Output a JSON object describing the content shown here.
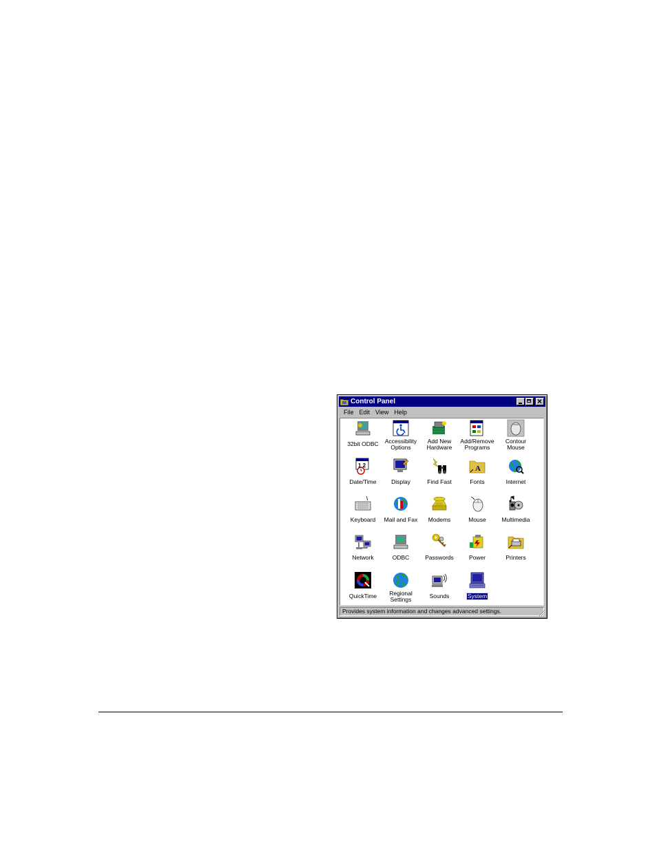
{
  "window": {
    "title": "Control Panel"
  },
  "menu": [
    "File",
    "Edit",
    "View",
    "Help"
  ],
  "items": [
    {
      "label": "32bit ODBC",
      "icon": "odbc32-icon"
    },
    {
      "label": "Accessibility\nOptions",
      "icon": "accessibility-icon"
    },
    {
      "label": "Add New\nHardware",
      "icon": "add-hardware-icon"
    },
    {
      "label": "Add/Remove\nPrograms",
      "icon": "add-remove-programs-icon"
    },
    {
      "label": "Contour\nMouse",
      "icon": "contour-mouse-icon"
    },
    {
      "label": "Date/Time",
      "icon": "date-time-icon"
    },
    {
      "label": "Display",
      "icon": "display-icon"
    },
    {
      "label": "Find Fast",
      "icon": "find-fast-icon"
    },
    {
      "label": "Fonts",
      "icon": "fonts-folder-icon"
    },
    {
      "label": "Internet",
      "icon": "internet-icon"
    },
    {
      "label": "Keyboard",
      "icon": "keyboard-icon"
    },
    {
      "label": "Mail and Fax",
      "icon": "mail-fax-icon"
    },
    {
      "label": "Modems",
      "icon": "modem-icon"
    },
    {
      "label": "Mouse",
      "icon": "mouse-icon"
    },
    {
      "label": "Multimedia",
      "icon": "multimedia-icon"
    },
    {
      "label": "Network",
      "icon": "network-icon"
    },
    {
      "label": "ODBC",
      "icon": "odbc-icon"
    },
    {
      "label": "Passwords",
      "icon": "passwords-icon"
    },
    {
      "label": "Power",
      "icon": "power-icon"
    },
    {
      "label": "Printers",
      "icon": "printers-folder-icon"
    },
    {
      "label": "QuickTime",
      "icon": "quicktime-icon"
    },
    {
      "label": "Regional\nSettings",
      "icon": "globe-icon"
    },
    {
      "label": "Sounds",
      "icon": "sounds-icon"
    },
    {
      "label": "System",
      "icon": "system-computer-icon",
      "selected": true
    }
  ],
  "status": "Provides system information and changes advanced settings.",
  "colors": {
    "titlebar": "#000080",
    "face": "#c0c0c0",
    "selection": "#000080"
  }
}
